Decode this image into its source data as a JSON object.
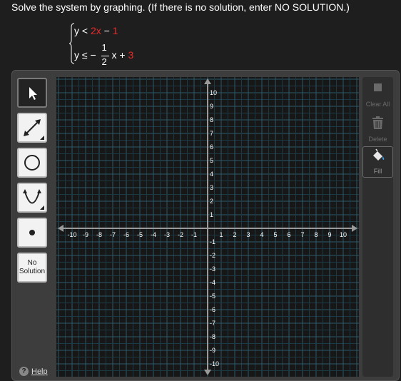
{
  "prompt": "Solve the system by graphing. (If there is no solution, enter NO SOLUTION.)",
  "system": {
    "eq1": {
      "lhs": "y < ",
      "coef": "2x",
      "mid": " − ",
      "const": "1"
    },
    "eq2": {
      "lhs": "y ≤ − ",
      "num": "1",
      "den": "2",
      "x": "x + ",
      "const": "3"
    }
  },
  "tools": [
    {
      "name": "select-tool",
      "icon": "arrow-cursor-icon"
    },
    {
      "name": "line-tool",
      "icon": "double-arrow-line-icon"
    },
    {
      "name": "circle-tool",
      "icon": "circle-icon"
    },
    {
      "name": "parabola-tool",
      "icon": "parabola-icon"
    },
    {
      "name": "point-tool",
      "icon": "point-icon"
    },
    {
      "name": "no-solution-button",
      "label": "No\nSolution"
    }
  ],
  "help_label": "Help",
  "actions": {
    "clear_all": "Clear All",
    "delete": "Delete",
    "fill": "Fill"
  },
  "graph": {
    "xmin": -10,
    "xmax": 10,
    "ymin": -10,
    "ymax": 10,
    "grid": true,
    "colors": {
      "background": "#171717",
      "grid_minor": "#1c3a46",
      "grid_major": "#2c5a6a",
      "axis": "#9a9a9a",
      "label": "#ffffff"
    }
  }
}
